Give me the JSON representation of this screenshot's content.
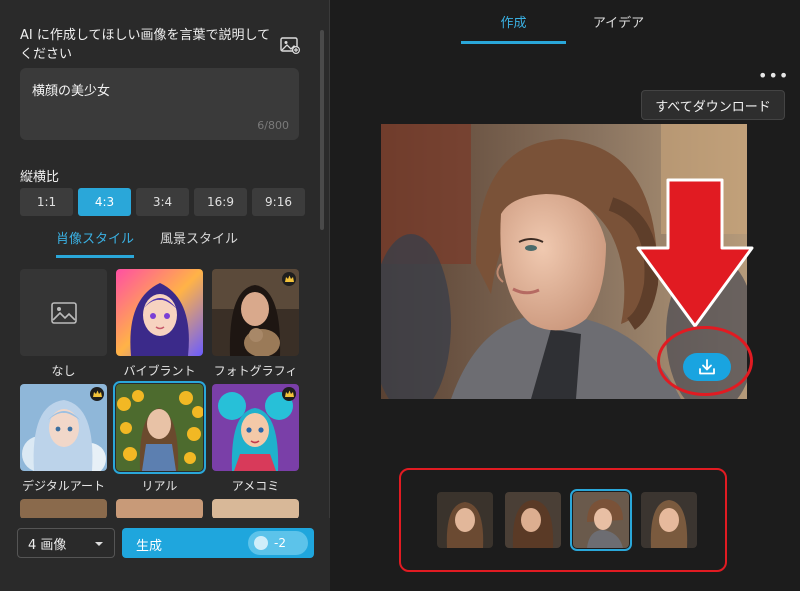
{
  "left": {
    "prompt_label": "AI に作成してほしい画像を言葉で説明してください",
    "prompt_value": "横顔の美少女",
    "prompt_count": "6/800",
    "ratio_label": "縦横比",
    "ratios": [
      "1:1",
      "4:3",
      "3:4",
      "16:9",
      "9:16"
    ],
    "selected_ratio": "4:3",
    "style_tabs": [
      "肖像スタイル",
      "風景スタイル"
    ],
    "styles": [
      {
        "label": "なし",
        "premium": false
      },
      {
        "label": "バイブラント",
        "premium": false
      },
      {
        "label": "フォトグラフィ",
        "premium": true
      },
      {
        "label": "デジタルアート",
        "premium": true
      },
      {
        "label": "リアル",
        "premium": false
      },
      {
        "label": "アメコミ",
        "premium": true
      }
    ],
    "image_count": "4 画像",
    "generate_label": "生成",
    "cost": "-2"
  },
  "right": {
    "tabs": [
      "作成",
      "アイデア"
    ],
    "more_label": "•••",
    "download_all_tooltip": "すべてダウンロード"
  },
  "colors": {
    "accent": "#2aa7d9",
    "annotation_red": "#e11b22"
  }
}
